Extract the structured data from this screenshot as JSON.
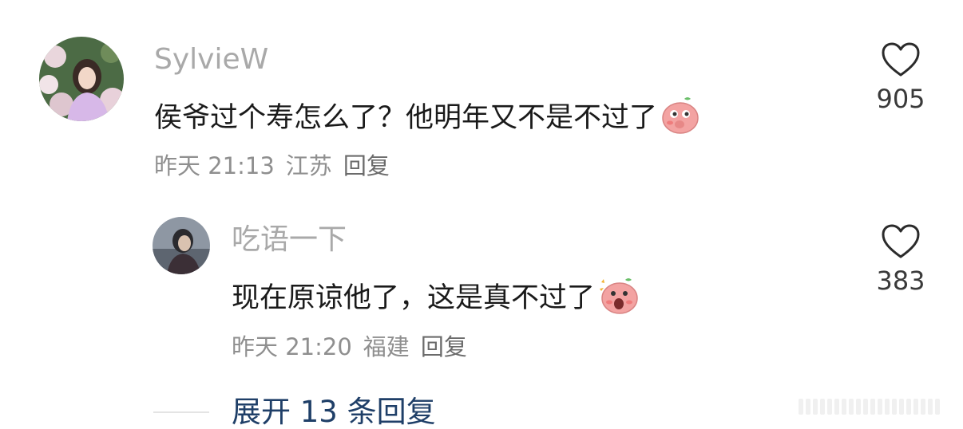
{
  "comments": [
    {
      "username": "SylvieW",
      "text": "侯爷过个寿怎么了？他明年又不是不过了",
      "time": "昨天 21:13",
      "location": "江苏",
      "reply_label": "回复",
      "like_count": "905",
      "emoji_icon": "pig-blush-emoji"
    },
    {
      "username": "吃语一下",
      "text": "现在原谅他了，这是真不过了",
      "time": "昨天 21:20",
      "location": "福建",
      "reply_label": "回复",
      "like_count": "383",
      "emoji_icon": "pig-shock-emoji"
    }
  ],
  "expand_label": "展开 13 条回复",
  "colors": {
    "username": "#a9a9a9",
    "text": "#1a1a1a",
    "meta": "#8f8f8f",
    "expand": "#1f3f68",
    "pig": "#f3a3a2"
  }
}
